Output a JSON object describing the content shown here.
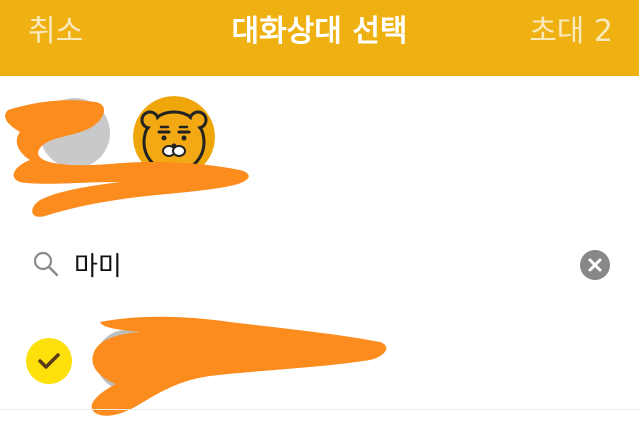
{
  "header": {
    "cancel_label": "취소",
    "title": "대화상대 선택",
    "invite_label": "초대 2"
  },
  "selected": {
    "items": [
      {
        "avatar": "blurred-avatar"
      },
      {
        "avatar": "ryan-character-avatar"
      }
    ]
  },
  "search": {
    "icon": "search-icon",
    "value": "마미",
    "clear_icon": "clear-icon"
  },
  "results": {
    "items": [
      {
        "checked": true,
        "check_icon": "checkmark-icon",
        "name_redacted": true
      }
    ]
  },
  "colors": {
    "header_bg": "#efb012",
    "check_bg": "#fddf0a",
    "redaction": "#fb8c1d"
  }
}
